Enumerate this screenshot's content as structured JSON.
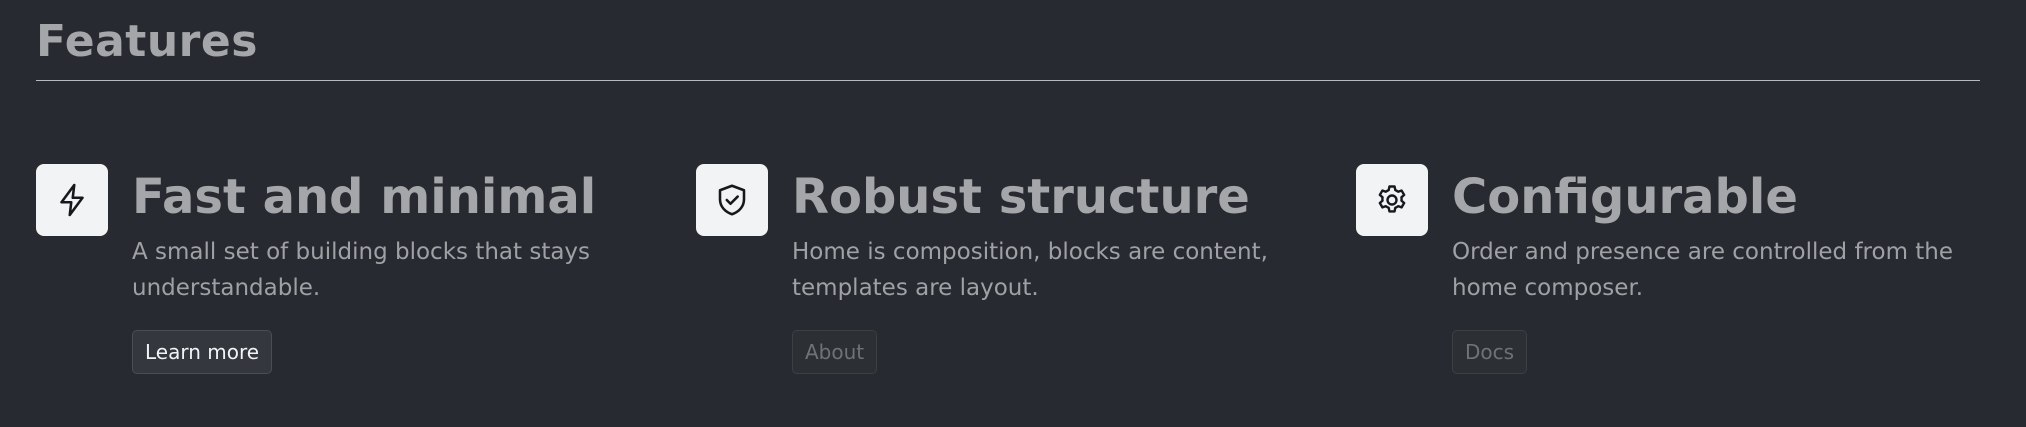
{
  "section": {
    "title": "Features"
  },
  "features": [
    {
      "icon": "lightning-icon",
      "title": "Fast and minimal",
      "description": "A small set of building blocks that stays understandable.",
      "button_label": "Learn more"
    },
    {
      "icon": "shield-check-icon",
      "title": "Robust structure",
      "description": "Home is composition, blocks are content, templates are layout.",
      "button_label": "About"
    },
    {
      "icon": "gear-icon",
      "title": "Configurable",
      "description": "Order and presence are controlled from the home composer.",
      "button_label": "Docs"
    }
  ],
  "colors": {
    "background": "#272a30",
    "icon_tile": "#f1f3f5",
    "title_text": "#a4a6a9",
    "primary_button_text": "#f2f3f4",
    "muted_button_text": "#6f7276"
  }
}
